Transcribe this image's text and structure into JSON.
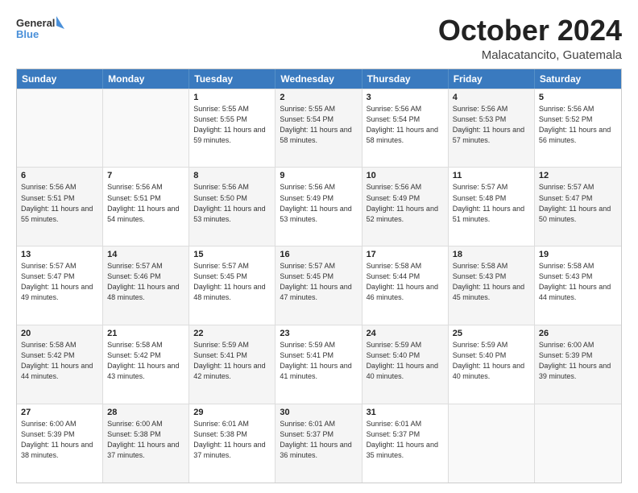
{
  "header": {
    "logo_general": "General",
    "logo_blue": "Blue",
    "month": "October 2024",
    "location": "Malacatancito, Guatemala"
  },
  "days_of_week": [
    "Sunday",
    "Monday",
    "Tuesday",
    "Wednesday",
    "Thursday",
    "Friday",
    "Saturday"
  ],
  "weeks": [
    [
      {
        "day": "",
        "sunrise": "",
        "sunset": "",
        "daylight": "",
        "shaded": false,
        "empty": true
      },
      {
        "day": "",
        "sunrise": "",
        "sunset": "",
        "daylight": "",
        "shaded": false,
        "empty": true
      },
      {
        "day": "1",
        "sunrise": "Sunrise: 5:55 AM",
        "sunset": "Sunset: 5:55 PM",
        "daylight": "Daylight: 11 hours and 59 minutes.",
        "shaded": false,
        "empty": false
      },
      {
        "day": "2",
        "sunrise": "Sunrise: 5:55 AM",
        "sunset": "Sunset: 5:54 PM",
        "daylight": "Daylight: 11 hours and 58 minutes.",
        "shaded": true,
        "empty": false
      },
      {
        "day": "3",
        "sunrise": "Sunrise: 5:56 AM",
        "sunset": "Sunset: 5:54 PM",
        "daylight": "Daylight: 11 hours and 58 minutes.",
        "shaded": false,
        "empty": false
      },
      {
        "day": "4",
        "sunrise": "Sunrise: 5:56 AM",
        "sunset": "Sunset: 5:53 PM",
        "daylight": "Daylight: 11 hours and 57 minutes.",
        "shaded": true,
        "empty": false
      },
      {
        "day": "5",
        "sunrise": "Sunrise: 5:56 AM",
        "sunset": "Sunset: 5:52 PM",
        "daylight": "Daylight: 11 hours and 56 minutes.",
        "shaded": false,
        "empty": false
      }
    ],
    [
      {
        "day": "6",
        "sunrise": "Sunrise: 5:56 AM",
        "sunset": "Sunset: 5:51 PM",
        "daylight": "Daylight: 11 hours and 55 minutes.",
        "shaded": true,
        "empty": false
      },
      {
        "day": "7",
        "sunrise": "Sunrise: 5:56 AM",
        "sunset": "Sunset: 5:51 PM",
        "daylight": "Daylight: 11 hours and 54 minutes.",
        "shaded": false,
        "empty": false
      },
      {
        "day": "8",
        "sunrise": "Sunrise: 5:56 AM",
        "sunset": "Sunset: 5:50 PM",
        "daylight": "Daylight: 11 hours and 53 minutes.",
        "shaded": true,
        "empty": false
      },
      {
        "day": "9",
        "sunrise": "Sunrise: 5:56 AM",
        "sunset": "Sunset: 5:49 PM",
        "daylight": "Daylight: 11 hours and 53 minutes.",
        "shaded": false,
        "empty": false
      },
      {
        "day": "10",
        "sunrise": "Sunrise: 5:56 AM",
        "sunset": "Sunset: 5:49 PM",
        "daylight": "Daylight: 11 hours and 52 minutes.",
        "shaded": true,
        "empty": false
      },
      {
        "day": "11",
        "sunrise": "Sunrise: 5:57 AM",
        "sunset": "Sunset: 5:48 PM",
        "daylight": "Daylight: 11 hours and 51 minutes.",
        "shaded": false,
        "empty": false
      },
      {
        "day": "12",
        "sunrise": "Sunrise: 5:57 AM",
        "sunset": "Sunset: 5:47 PM",
        "daylight": "Daylight: 11 hours and 50 minutes.",
        "shaded": true,
        "empty": false
      }
    ],
    [
      {
        "day": "13",
        "sunrise": "Sunrise: 5:57 AM",
        "sunset": "Sunset: 5:47 PM",
        "daylight": "Daylight: 11 hours and 49 minutes.",
        "shaded": false,
        "empty": false
      },
      {
        "day": "14",
        "sunrise": "Sunrise: 5:57 AM",
        "sunset": "Sunset: 5:46 PM",
        "daylight": "Daylight: 11 hours and 48 minutes.",
        "shaded": true,
        "empty": false
      },
      {
        "day": "15",
        "sunrise": "Sunrise: 5:57 AM",
        "sunset": "Sunset: 5:45 PM",
        "daylight": "Daylight: 11 hours and 48 minutes.",
        "shaded": false,
        "empty": false
      },
      {
        "day": "16",
        "sunrise": "Sunrise: 5:57 AM",
        "sunset": "Sunset: 5:45 PM",
        "daylight": "Daylight: 11 hours and 47 minutes.",
        "shaded": true,
        "empty": false
      },
      {
        "day": "17",
        "sunrise": "Sunrise: 5:58 AM",
        "sunset": "Sunset: 5:44 PM",
        "daylight": "Daylight: 11 hours and 46 minutes.",
        "shaded": false,
        "empty": false
      },
      {
        "day": "18",
        "sunrise": "Sunrise: 5:58 AM",
        "sunset": "Sunset: 5:43 PM",
        "daylight": "Daylight: 11 hours and 45 minutes.",
        "shaded": true,
        "empty": false
      },
      {
        "day": "19",
        "sunrise": "Sunrise: 5:58 AM",
        "sunset": "Sunset: 5:43 PM",
        "daylight": "Daylight: 11 hours and 44 minutes.",
        "shaded": false,
        "empty": false
      }
    ],
    [
      {
        "day": "20",
        "sunrise": "Sunrise: 5:58 AM",
        "sunset": "Sunset: 5:42 PM",
        "daylight": "Daylight: 11 hours and 44 minutes.",
        "shaded": true,
        "empty": false
      },
      {
        "day": "21",
        "sunrise": "Sunrise: 5:58 AM",
        "sunset": "Sunset: 5:42 PM",
        "daylight": "Daylight: 11 hours and 43 minutes.",
        "shaded": false,
        "empty": false
      },
      {
        "day": "22",
        "sunrise": "Sunrise: 5:59 AM",
        "sunset": "Sunset: 5:41 PM",
        "daylight": "Daylight: 11 hours and 42 minutes.",
        "shaded": true,
        "empty": false
      },
      {
        "day": "23",
        "sunrise": "Sunrise: 5:59 AM",
        "sunset": "Sunset: 5:41 PM",
        "daylight": "Daylight: 11 hours and 41 minutes.",
        "shaded": false,
        "empty": false
      },
      {
        "day": "24",
        "sunrise": "Sunrise: 5:59 AM",
        "sunset": "Sunset: 5:40 PM",
        "daylight": "Daylight: 11 hours and 40 minutes.",
        "shaded": true,
        "empty": false
      },
      {
        "day": "25",
        "sunrise": "Sunrise: 5:59 AM",
        "sunset": "Sunset: 5:40 PM",
        "daylight": "Daylight: 11 hours and 40 minutes.",
        "shaded": false,
        "empty": false
      },
      {
        "day": "26",
        "sunrise": "Sunrise: 6:00 AM",
        "sunset": "Sunset: 5:39 PM",
        "daylight": "Daylight: 11 hours and 39 minutes.",
        "shaded": true,
        "empty": false
      }
    ],
    [
      {
        "day": "27",
        "sunrise": "Sunrise: 6:00 AM",
        "sunset": "Sunset: 5:39 PM",
        "daylight": "Daylight: 11 hours and 38 minutes.",
        "shaded": false,
        "empty": false
      },
      {
        "day": "28",
        "sunrise": "Sunrise: 6:00 AM",
        "sunset": "Sunset: 5:38 PM",
        "daylight": "Daylight: 11 hours and 37 minutes.",
        "shaded": true,
        "empty": false
      },
      {
        "day": "29",
        "sunrise": "Sunrise: 6:01 AM",
        "sunset": "Sunset: 5:38 PM",
        "daylight": "Daylight: 11 hours and 37 minutes.",
        "shaded": false,
        "empty": false
      },
      {
        "day": "30",
        "sunrise": "Sunrise: 6:01 AM",
        "sunset": "Sunset: 5:37 PM",
        "daylight": "Daylight: 11 hours and 36 minutes.",
        "shaded": true,
        "empty": false
      },
      {
        "day": "31",
        "sunrise": "Sunrise: 6:01 AM",
        "sunset": "Sunset: 5:37 PM",
        "daylight": "Daylight: 11 hours and 35 minutes.",
        "shaded": false,
        "empty": false
      },
      {
        "day": "",
        "sunrise": "",
        "sunset": "",
        "daylight": "",
        "shaded": true,
        "empty": true
      },
      {
        "day": "",
        "sunrise": "",
        "sunset": "",
        "daylight": "",
        "shaded": false,
        "empty": true
      }
    ]
  ]
}
